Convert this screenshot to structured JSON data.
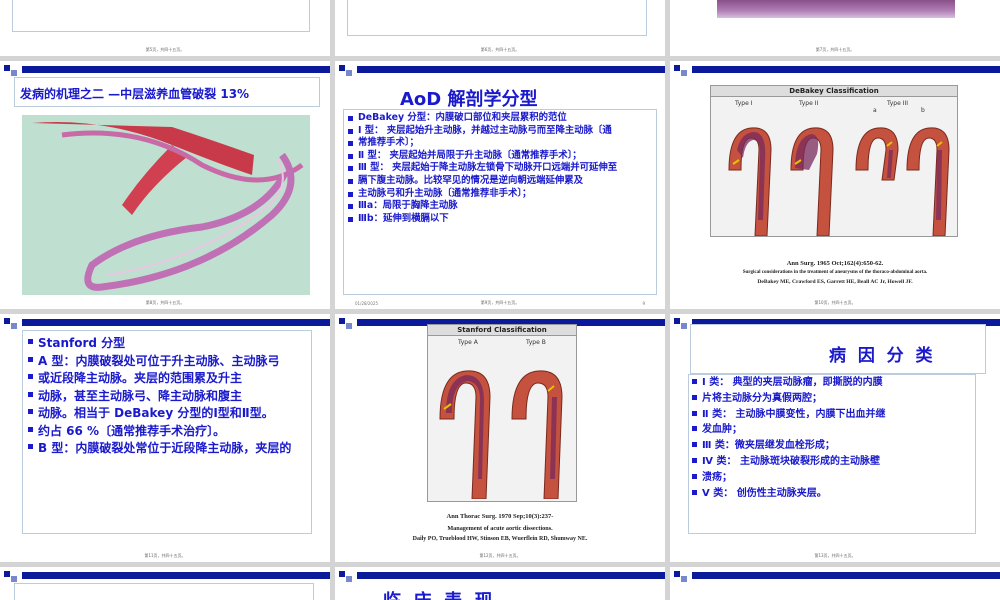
{
  "slides": [
    {
      "page": "第5页，共四十五页。"
    },
    {
      "page": "第6页，共四十五页。"
    },
    {
      "page": "第7页，共四十五页。"
    },
    {
      "page": "第8页，共四十五页。",
      "title": "发病的机理之二 —中层滋养血管破裂 13%"
    },
    {
      "page": "第9页，共四十五页。",
      "title": "AoD 解剖学分型",
      "date": "01/28/2025",
      "num": "9",
      "lines": [
        "DeBakey 分型：内膜破口部位和夹层累积的范位",
        "Ⅰ 型：    夹层起始升主动脉，并越过主动脉弓而至降主动脉〔通",
        "         常推荐手术〕；",
        "Ⅱ 型：   夹层起始并局限于升主动脉〔通常推荐手术〕；",
        "Ⅲ 型：   夹层起始于降主动脉左锁骨下动脉开口远端并可延伸至",
        "         膈下腹主动脉。比较罕见的情况是逆向朝远端延伸累及",
        "         主动脉弓和升主动脉〔通常推荐非手术〕；",
        "            Ⅲa：局限于胸降主动脉",
        "            Ⅲb：延伸到横膈以下"
      ]
    },
    {
      "page": "第10页，共四十五页。",
      "fig_title": "DeBakey Classification",
      "types": [
        "Type I",
        "Type II",
        "Type III"
      ],
      "sub": [
        "a",
        "b"
      ],
      "cite1": "Ann Surg. 1965 Oct;162(4):650-62.",
      "cite2": "Surgical considerations in the treatment of aneurysms of the thoraco-abdominal aorta.",
      "cite3": "DeBakey ME, Crawford ES, Garrett HE, Beall AC Jr, Howell JF."
    },
    {
      "page": "第11页，共四十五页。",
      "lines": [
        "Stanford 分型",
        "A 型：内膜破裂处可位于升主动脉、主动脉弓",
        "      或近段降主动脉。夹层的范围累及升主",
        "      动脉，甚至主动脉弓、降主动脉和腹主",
        "      动脉。相当于 DeBakey 分型的Ⅰ型和Ⅱ型。",
        "      约占 66 %〔通常推荐手术治疗〕。",
        "B 型：内膜破裂处常位于近段降主动脉，夹层的"
      ]
    },
    {
      "page": "第12页，共四十五页。",
      "fig_title": "Stanford Classification",
      "types": [
        "Type A",
        "Type B"
      ],
      "cite1": "Ann Thorac Surg. 1970 Sep;10(3):237-",
      "cite2": "Management of acute aortic dissections.",
      "cite3": "Daily PO, Trueblood HW, Stinson EB, Wuerflein RD, Shumway NE."
    },
    {
      "page": "第13页，共四十五页。",
      "title": "病  因  分  类",
      "lines": [
        "Ⅰ 类：    典型的夹层动脉瘤，即撕脱的内膜",
        "          片将主动脉分为真假两腔；",
        "Ⅱ 类：  主动脉中膜变性，内膜下出血并继",
        "          发血肿；",
        "Ⅲ 类：微夹层继发血栓形成；",
        "Ⅳ 类：  主动脉斑块破裂形成的主动脉壁",
        "          溃疡；",
        "Ⅴ 类：    创伤性主动脉夹层。"
      ]
    },
    {
      "page": ""
    },
    {
      "title": "临  床  表  现"
    },
    {
      "page": ""
    }
  ],
  "colors": {
    "accent": "#0a1a9a",
    "text_blue": "#1a1acc",
    "bg": "#d4d4d4"
  }
}
